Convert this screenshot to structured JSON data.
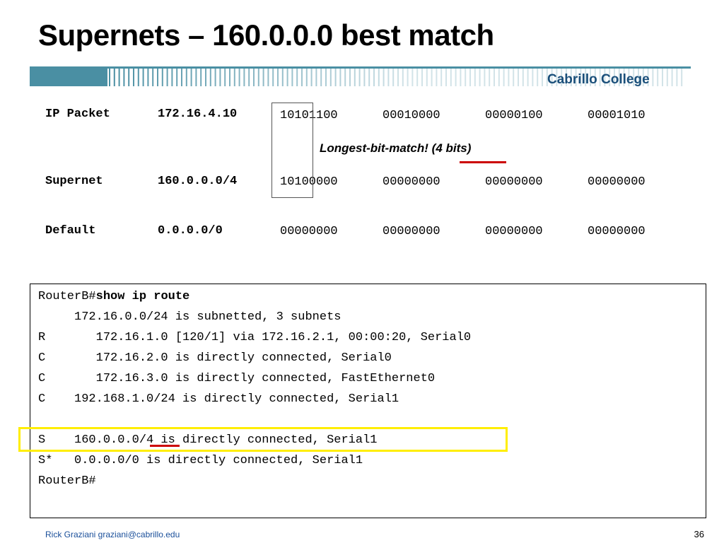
{
  "title": "Supernets – 160.0.0.0 best match",
  "brand": "Cabrillo College",
  "table": {
    "rows": [
      {
        "label": "IP Packet",
        "addr": "172.16.4.10",
        "bits": [
          "10101100",
          "00010000",
          "00000100",
          "00001010"
        ]
      },
      {
        "label": "Supernet",
        "addr": "160.0.0.0/4",
        "bits": [
          "10100000",
          "00000000",
          "00000000",
          "00000000"
        ]
      },
      {
        "label": "Default",
        "addr": "0.0.0.0/0",
        "bits": [
          "00000000",
          "00000000",
          "00000000",
          "00000000"
        ]
      }
    ],
    "annotation": "Longest-bit-match!   (4 bits)"
  },
  "terminal": {
    "prompt": "RouterB#",
    "command": "show ip route",
    "lines": [
      "     172.16.0.0/24 is subnetted, 3 subnets",
      "R       172.16.1.0 [120/1] via 172.16.2.1, 00:00:20, Serial0",
      "C       172.16.2.0 is directly connected, Serial0",
      "C       172.16.3.0 is directly connected, FastEthernet0",
      "C    192.168.1.0/24 is directly connected, Serial1",
      "",
      "S    160.0.0.0/4 is directly connected, Serial1",
      "S*   0.0.0.0/0 is directly connected, Serial1",
      "RouterB#"
    ]
  },
  "footer": {
    "author": "Rick Graziani  graziani@cabrillo.edu",
    "page": "36"
  },
  "colors": {
    "banner": "#4a8fa3",
    "highlight": "#ffee00",
    "underline": "#cc0000",
    "brand": "#1a4f7a"
  }
}
